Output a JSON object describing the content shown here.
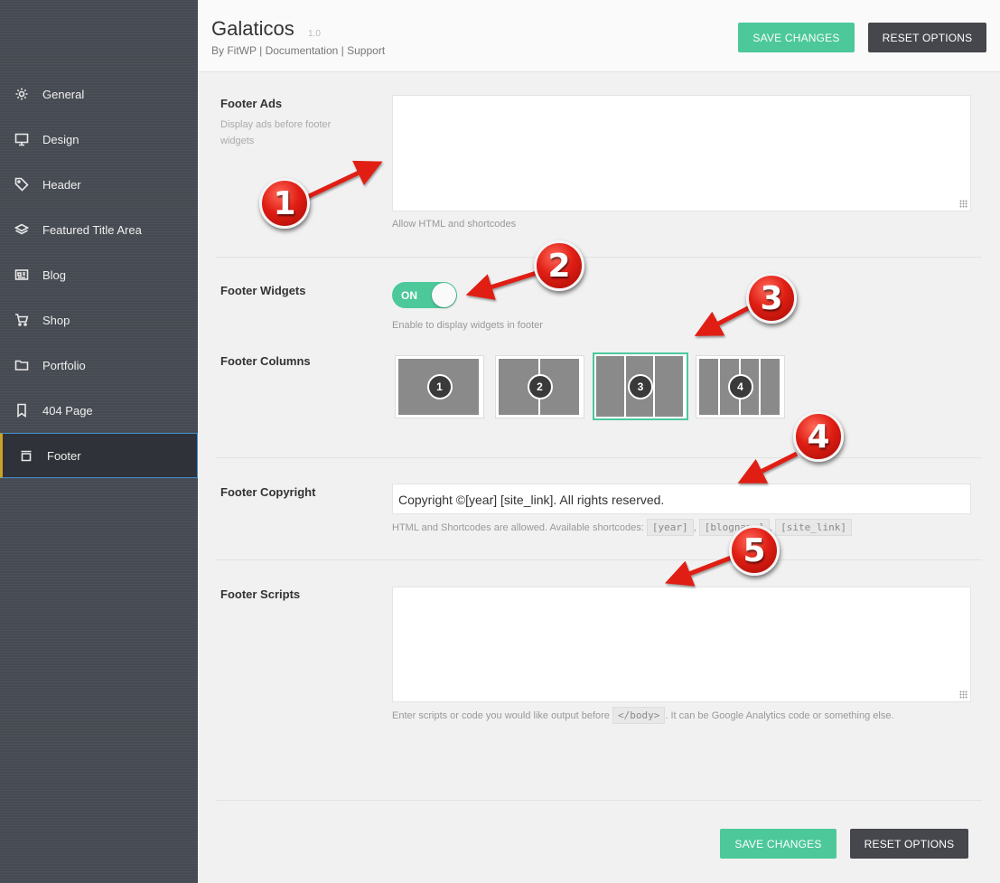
{
  "sidebar": {
    "items": [
      {
        "label": "General",
        "icon": "gear-icon"
      },
      {
        "label": "Design",
        "icon": "monitor-icon"
      },
      {
        "label": "Header",
        "icon": "tag-icon"
      },
      {
        "label": "Featured Title Area",
        "icon": "layers-icon"
      },
      {
        "label": "Blog",
        "icon": "news-icon"
      },
      {
        "label": "Shop",
        "icon": "cart-icon"
      },
      {
        "label": "Portfolio",
        "icon": "folder-icon"
      },
      {
        "label": "404 Page",
        "icon": "bookmark-icon"
      },
      {
        "label": "Footer",
        "icon": "archive-icon",
        "active": true
      }
    ]
  },
  "header": {
    "title": "Galaticos",
    "version": "1.0",
    "by": "By FitWP",
    "sep1": "|",
    "documentation": "Documentation",
    "sep2": "|",
    "support": "Support",
    "save_label": "SAVE CHANGES",
    "reset_label": "RESET OPTIONS"
  },
  "footer_ads": {
    "label": "Footer Ads",
    "description": "Display ads before footer widgets",
    "value": "",
    "hint": "Allow HTML and shortcodes"
  },
  "footer_widgets": {
    "label": "Footer Widgets",
    "toggle_text": "ON",
    "enabled": true,
    "hint": "Enable to display widgets in footer"
  },
  "footer_columns": {
    "label": "Footer Columns",
    "options": [
      "1",
      "2",
      "3",
      "4"
    ],
    "selected": "3"
  },
  "footer_copyright": {
    "label": "Footer Copyright",
    "value": "Copyright ©[year] [site_link]. All rights reserved.",
    "hint_prefix": "HTML and Shortcodes are allowed. Available shortcodes:",
    "codes": [
      "[year]",
      "[blogname]",
      "[site_link]"
    ],
    "comma": ","
  },
  "footer_scripts": {
    "label": "Footer Scripts",
    "value": "",
    "hint_prefix": "Enter scripts or code you would like output before",
    "hint_code": "</body>",
    "hint_suffix": ". It can be Google Analytics code or something else."
  },
  "bottom": {
    "save_label": "SAVE CHANGES",
    "reset_label": "RESET OPTIONS"
  },
  "annotations": [
    "1",
    "2",
    "3",
    "4",
    "5"
  ],
  "colors": {
    "accent": "#4cc89a",
    "sidebar": "#464a52",
    "dark_button": "#45474d",
    "annotation_red": "#e01e14"
  }
}
